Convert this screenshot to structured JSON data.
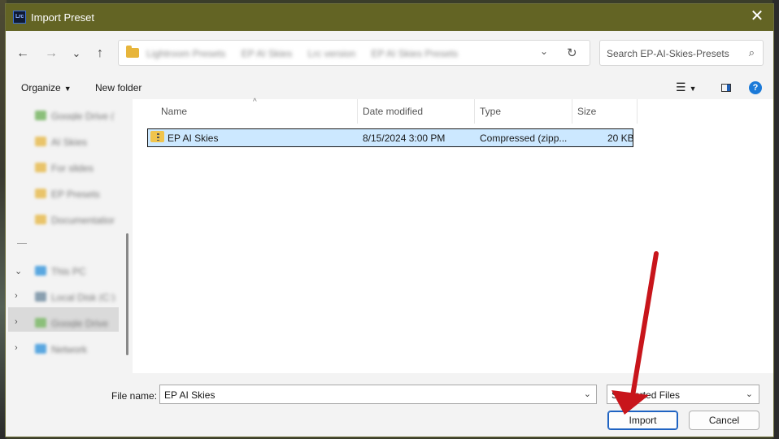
{
  "window": {
    "title": "Import Preset",
    "app_icon_text": "Lrc",
    "close_glyph": "✕"
  },
  "nav": {
    "back": "←",
    "forward": "→",
    "recent": "⌄",
    "up": "↑",
    "breadcrumbs": [
      "Lightroom Presets",
      "EP AI Skies",
      "Lrc version",
      "EP AI Skies Presets"
    ],
    "dropdown": "⌄",
    "refresh": "↻"
  },
  "search": {
    "placeholder": "Search EP-AI-Skies-Presets",
    "icon": "⌕"
  },
  "toolbar": {
    "organize": "Organize",
    "organize_caret": "▼",
    "new_folder": "New folder",
    "view_icon": "☰",
    "view_caret": "▼",
    "help": "?"
  },
  "sidebar": {
    "items": [
      {
        "label": "Google Drive (G:)",
        "color": "#8bbf7a"
      },
      {
        "label": "AI Skies",
        "color": "#e9c46a"
      },
      {
        "label": "For slides",
        "color": "#e9c46a"
      },
      {
        "label": "EP Presets",
        "color": "#e9c46a"
      },
      {
        "label": "Documentation",
        "color": "#e9c46a"
      },
      {
        "label": "This PC",
        "color": "#5aa7e0"
      },
      {
        "label": "Local Disk (C:)",
        "color": "#8aa0b0"
      },
      {
        "label": "Google Drive",
        "color": "#8bbf7a"
      },
      {
        "label": "Network",
        "color": "#5aa7e0"
      }
    ]
  },
  "columns": {
    "name": "Name",
    "date": "Date modified",
    "type": "Type",
    "size": "Size",
    "sort_glyph": "^"
  },
  "files": [
    {
      "name": "EP AI Skies",
      "date": "8/15/2024 3:00 PM",
      "type": "Compressed (zipp...",
      "size": "20 KB"
    }
  ],
  "footer": {
    "file_name_label": "File name:",
    "file_name_value": "EP AI Skies",
    "file_type": "Supported Files",
    "import": "Import",
    "cancel": "Cancel",
    "dropdown": "⌄"
  },
  "annotation": {
    "arrow_color": "#c8151b"
  }
}
